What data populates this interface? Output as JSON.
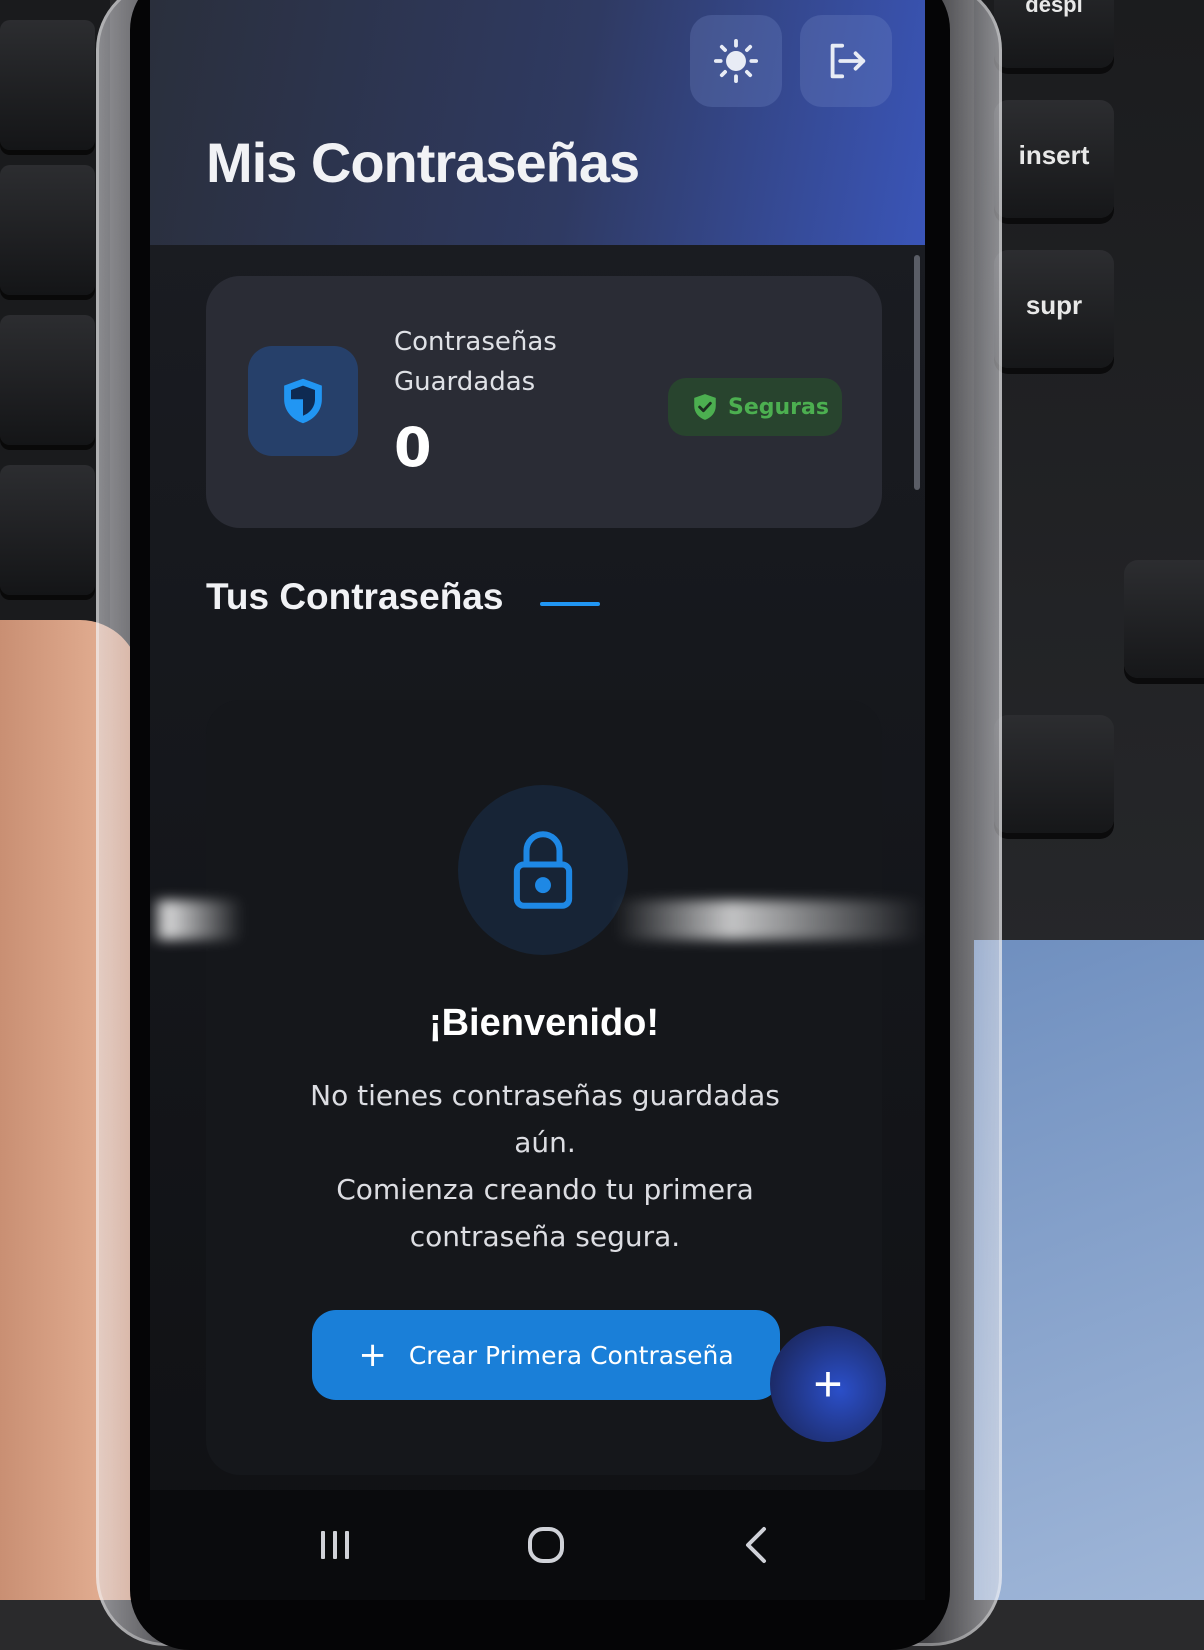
{
  "keyboard": {
    "keys": [
      "despl",
      "insert",
      "supr"
    ]
  },
  "header": {
    "title": "Mis Contraseñas",
    "theme_toggle_icon": "sun-icon",
    "logout_icon": "logout-icon"
  },
  "stats": {
    "label": "Contraseñas Guardadas",
    "count": "0",
    "badge": "Seguras",
    "icon": "shield-icon",
    "badge_icon": "check-shield-icon"
  },
  "section": {
    "title": "Tus Contraseñas"
  },
  "empty_state": {
    "icon": "lock-icon",
    "title": "¡Bienvenido!",
    "message": "No tienes contraseñas guardadas aún.\nComienza creando tu primera contraseña segura.",
    "cta_label": "Crear Primera Contraseña",
    "cta_icon": "plus-icon"
  },
  "fab": {
    "label": "+"
  },
  "nav": {
    "recents_icon": "recents-icon",
    "home_icon": "home-icon",
    "back_icon": "back-icon"
  },
  "colors": {
    "accent": "#1a7fd8",
    "header_gradient_end": "#3a55b8",
    "badge_green": "#4caf50",
    "card_bg": "#2a2c35"
  }
}
